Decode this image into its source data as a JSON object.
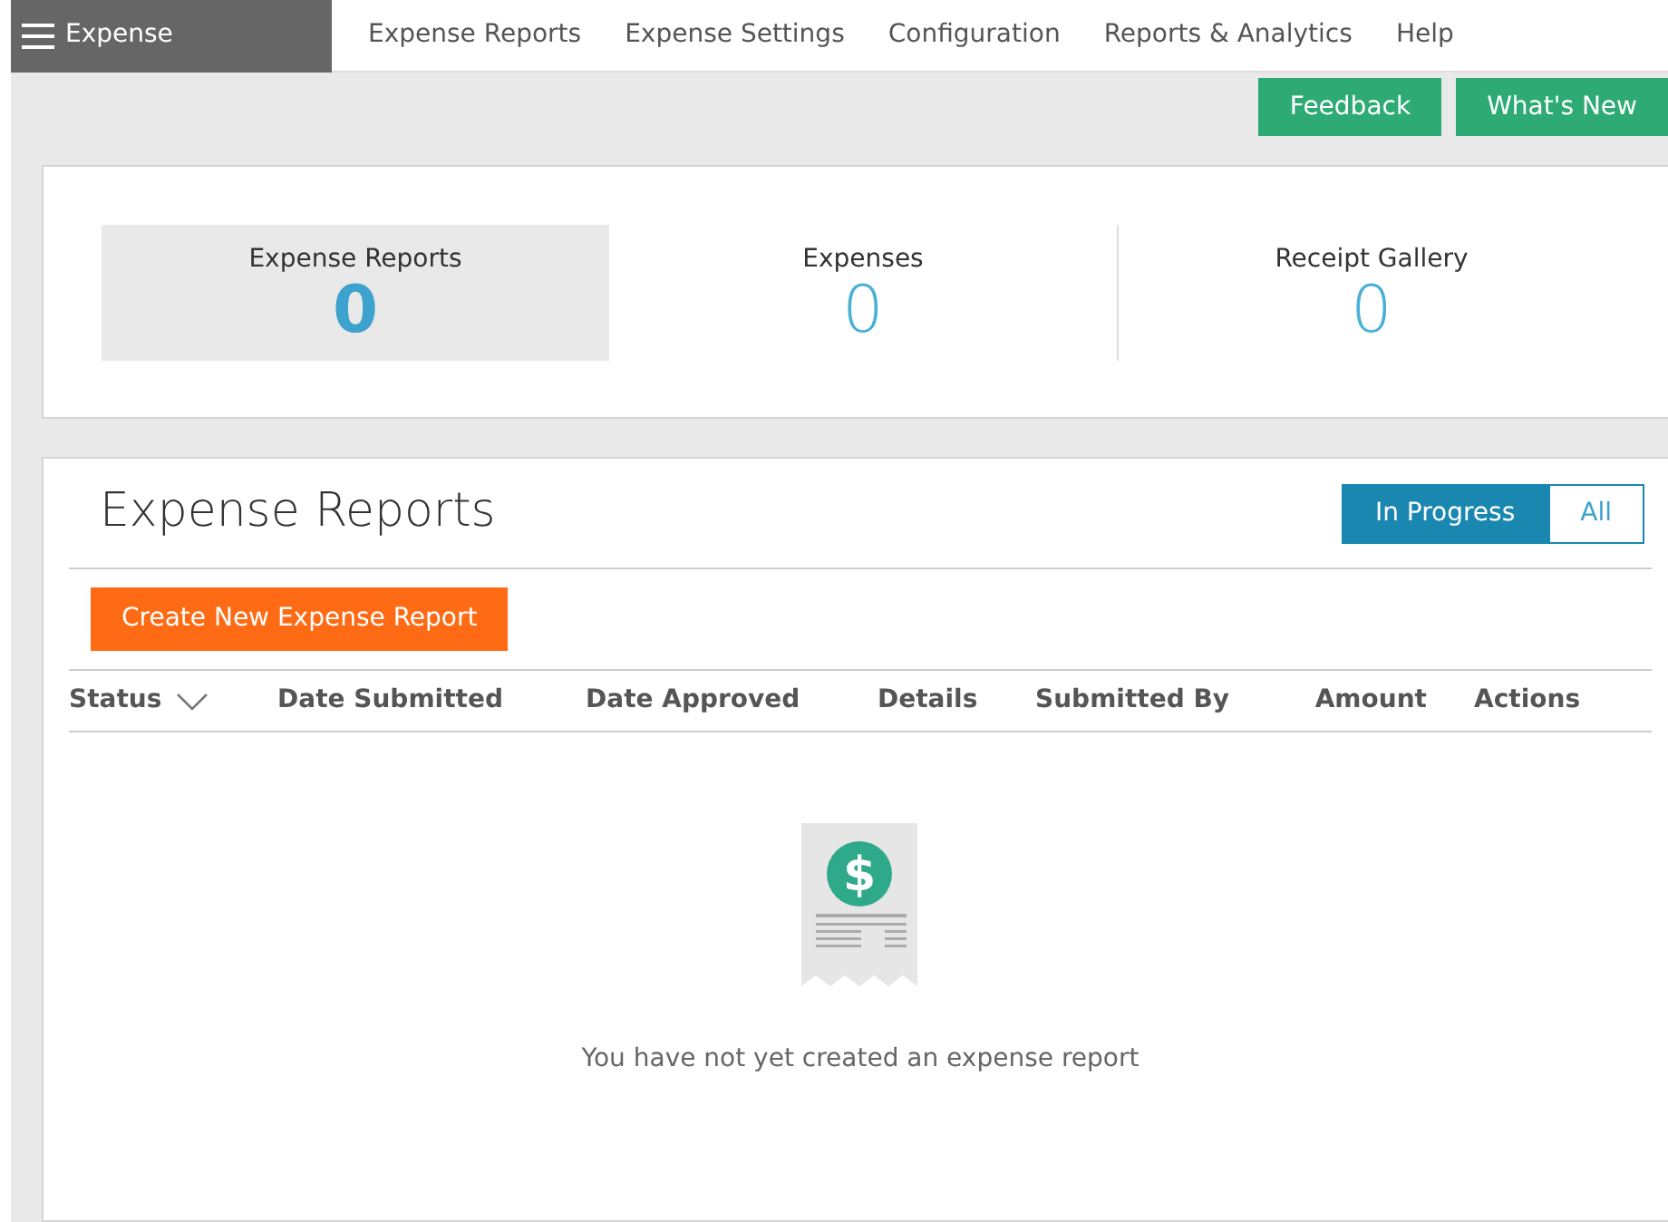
{
  "brand": {
    "label": "Expense"
  },
  "nav": [
    "Expense Reports",
    "Expense Settings",
    "Configuration",
    "Reports & Analytics",
    "Help"
  ],
  "actions": [
    "Feedback",
    "What's New"
  ],
  "stats": [
    {
      "label": "Expense Reports",
      "count": "0",
      "selected": true
    },
    {
      "label": "Expenses",
      "count": "0",
      "selected": false
    },
    {
      "label": "Receipt Gallery",
      "count": "0",
      "selected": false
    }
  ],
  "reports": {
    "title": "Expense Reports",
    "filters": [
      {
        "label": "In Progress",
        "selected": true
      },
      {
        "label": "All",
        "selected": false
      }
    ],
    "create_button": "Create New Expense Report",
    "columns": [
      {
        "label": "Status",
        "sortable": true
      },
      {
        "label": "Date Submitted",
        "sortable": false
      },
      {
        "label": "Date Approved",
        "sortable": false
      },
      {
        "label": "Details",
        "sortable": false
      },
      {
        "label": "Submitted By",
        "sortable": false
      },
      {
        "label": "Amount",
        "sortable": false
      },
      {
        "label": "Actions",
        "sortable": false
      }
    ],
    "empty": {
      "symbol": "$",
      "message": "You have not yet created an expense report"
    }
  }
}
